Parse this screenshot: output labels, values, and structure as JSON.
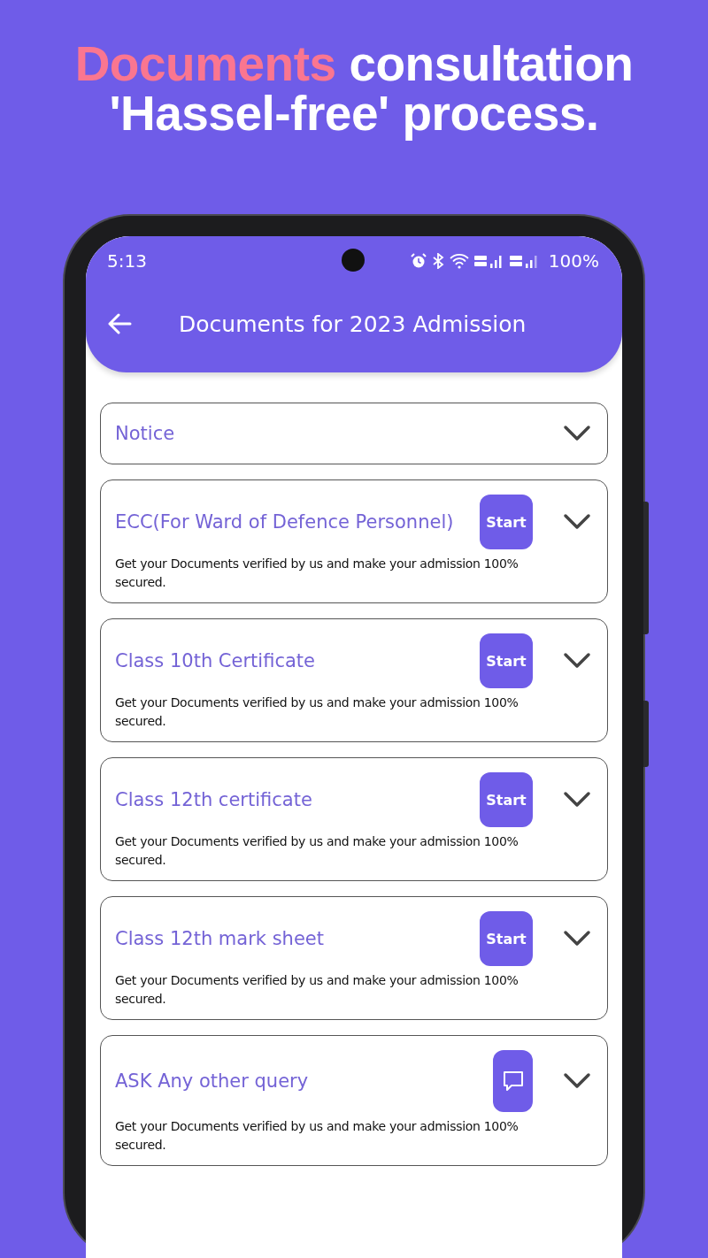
{
  "headline": {
    "accent": "Documents",
    "line1_rest": " consultation",
    "line2": "'Hassel-free' process."
  },
  "status_bar": {
    "time": "5:13",
    "battery": "100%"
  },
  "app_bar": {
    "title": "Documents for 2023 Admission"
  },
  "cards": [
    {
      "kind": "notice",
      "title": "Notice",
      "expanded": false
    },
    {
      "kind": "start",
      "title": "ECC(For Ward of Defence Personnel)",
      "button": "Start",
      "description": "Get your Documents verified by us and make your admission 100% secured.",
      "expanded": false
    },
    {
      "kind": "start",
      "title": "Class 10th Certificate",
      "button": "Start",
      "description": "Get your Documents verified by us and make your admission 100% secured.",
      "expanded": false
    },
    {
      "kind": "start",
      "title": "Class 12th certificate",
      "button": "Start",
      "description": "Get your Documents verified by us and make your admission 100% secured.",
      "expanded": false
    },
    {
      "kind": "start",
      "title": "Class 12th mark sheet",
      "button": "Start",
      "description": "Get your Documents verified by us and make your admission 100% secured.",
      "expanded": false
    },
    {
      "kind": "chat",
      "title": "ASK Any other query",
      "description": "Get your Documents verified by us and make your admission 100% secured.",
      "expanded": false
    }
  ]
}
